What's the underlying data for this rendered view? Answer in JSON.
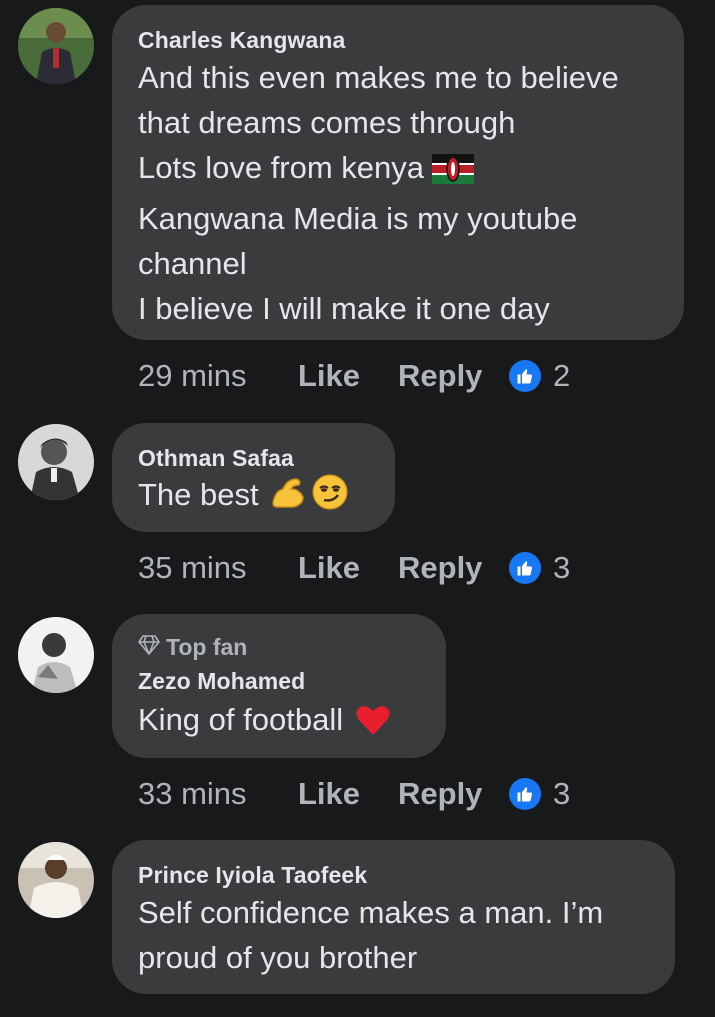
{
  "comments": [
    {
      "author": "Charles Kangwana",
      "lines": [
        "And this even makes me to believe",
        "that dreams comes through",
        "Lots love from kenya",
        "Kangwana Media is my youtube",
        "channel",
        "I believe I will make it one day"
      ],
      "time": "29 mins",
      "like_label": "Like",
      "reply_label": "Reply",
      "reaction_count": "2",
      "emoji": [
        "kenya-flag"
      ]
    },
    {
      "author": "Othman Safaa",
      "lines": [
        "The best"
      ],
      "time": "35 mins",
      "like_label": "Like",
      "reply_label": "Reply",
      "reaction_count": "3",
      "emoji": [
        "flexed-biceps",
        "smirking-face"
      ]
    },
    {
      "badge": "Top fan",
      "author": "Zezo Mohamed",
      "lines": [
        "King of football"
      ],
      "time": "33 mins",
      "like_label": "Like",
      "reply_label": "Reply",
      "reaction_count": "3",
      "emoji": [
        "red-heart"
      ]
    },
    {
      "author": "Prince Iyiola Taofeek",
      "lines": [
        "Self confidence makes a man. I’m",
        "proud of you brother"
      ]
    }
  ],
  "colors": {
    "background": "#18191a",
    "bubble": "#3a3b3c",
    "text": "#e4e6eb",
    "secondary_text": "#b0b3b8",
    "like_badge": "#1877f2"
  }
}
